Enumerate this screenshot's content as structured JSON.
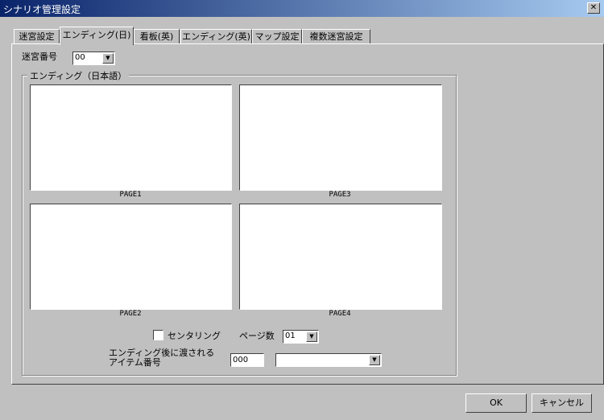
{
  "window": {
    "title": "シナリオ管理設定",
    "close_glyph": "✕"
  },
  "tabs": [
    {
      "label": "迷宮設定"
    },
    {
      "label": "エンディング(日)",
      "selected": true
    },
    {
      "label": "看板(英)"
    },
    {
      "label": "エンディング(英)"
    },
    {
      "label": "マップ設定"
    },
    {
      "label": "複数迷宮設定"
    }
  ],
  "maze": {
    "label": "迷宮番号",
    "value": "00"
  },
  "ending_group": {
    "legend": "エンディング（日本語）",
    "pages": [
      {
        "label": "PAGE1"
      },
      {
        "label": "PAGE3"
      },
      {
        "label": "PAGE2"
      },
      {
        "label": "PAGE4"
      }
    ],
    "centering": {
      "label": "センタリング",
      "checked": false
    },
    "page_count": {
      "label": "ページ数",
      "value": "01"
    },
    "item": {
      "label_line1": "エンディング後に渡される",
      "label_line2": "アイテム番号",
      "number": "000",
      "name": ""
    }
  },
  "buttons": {
    "ok": "OK",
    "cancel": "キャンセル"
  },
  "icons": {
    "dropdown": "triangle-down",
    "close": "x"
  }
}
